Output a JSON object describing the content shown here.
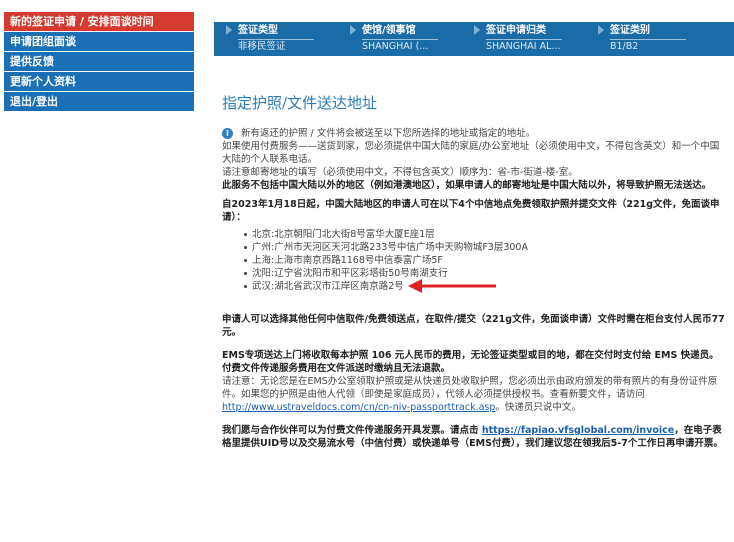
{
  "sidebar": {
    "items": [
      {
        "label": "新的签证申请 / 安排面谈时间",
        "active": true
      },
      {
        "label": "申请团组面谈",
        "active": false
      },
      {
        "label": "提供反馈",
        "active": false
      },
      {
        "label": "更新个人资料",
        "active": false
      },
      {
        "label": "退出/登出",
        "active": false
      }
    ]
  },
  "breadcrumb": [
    {
      "key": "签证类型",
      "value": "非移民签证"
    },
    {
      "key": "使馆/领事馆",
      "value": "SHANGHAI (..."
    },
    {
      "key": "签证申请归类",
      "value": "SHANGHAI AL..."
    },
    {
      "key": "签证类别",
      "value": "B1/B2"
    }
  ],
  "page": {
    "title": "指定护照/文件送达地址",
    "intro": "新有返还的护照 / 文件将会被送至以下您所选择的地址或指定的地址。",
    "para1": "如果使用付费服务——送货到家，您必须提供中国大陆的家庭/办公室地址（必须使用中文，不得包含英文）和一个中国大陆的个人联系电话。",
    "para2": "请注意邮寄地址的填写（必须使用中文，不得包含英文）顺序为：省-市-街道-楼-室。",
    "para3_bold": "此服务不包括中国大陆以外的地区（例如港澳地区），如果申请人的邮寄地址是中国大陆以外，将导致护照无法送达。",
    "para4_bold": "自2023年1月18日起，中国大陆地区的申请人可在以下4个中信地点免费领取护照并提交文件（221g文件，免面谈申请）：",
    "addresses": [
      "北京:北京朝阳门北大街8号富华大厦E座1层",
      "广州:广州市天河区天河北路233号中信广场中天购物城F3层300A",
      "上海:上海市南京西路1168号中信泰富广场5F",
      "沈阳:辽宁省沈阳市和平区彩塔街50号南湖支行",
      "武汉:湖北省武汉市江岸区南京路2号"
    ],
    "para5_bold": "申请人可以选择其他任何中信取件/免费领送点，在取件/提交（221g文件，免面谈申请）文件时需在柜台支付人民币77元。",
    "para6_bold": "EMS专项送达上门将收取每本护照 106 元人民币的费用，无论签证类型或目的地，都在交付时支付给 EMS 快递员。",
    "para7_bold": "付费文件传递服务费用在文件派送时缴纳且无法退款。",
    "para8": "请注意：无论您是在EMS办公室领取护照或是从快递员处收取护照，您必须出示由政府颁发的带有照片的有身份证件原件。如果您的护照是由他人代领（即使是家庭成员），代领人必须提供授权书。查看新要文件，请访问",
    "para8_link": "http://www.ustraveldocs.com/cn/cn-niv-passporttrack.asp",
    "para8_tail": "。快递员只说中文。",
    "para9_a": "我们愿与合作伙伴可以为付费文件传递服务开具发票。请点击",
    "para9_link": "https://fapiao.vfsglobal.com/invoice",
    "para9_b": "，在电子表格里提供UID号以及交易流水号（中信付费）或快递单号（EMS付费），我们建议您在领我后5-7个工作日再申请开票。"
  },
  "colors": {
    "sidebar_blue": "#1a6fb5",
    "sidebar_active_red": "#d43a2f",
    "topbar_blue": "#1b6ba6",
    "title_blue": "#2a7dbd",
    "arrow_red": "#e02020"
  },
  "icons": {
    "info": "info-icon",
    "arrow": "red-arrow-icon"
  }
}
